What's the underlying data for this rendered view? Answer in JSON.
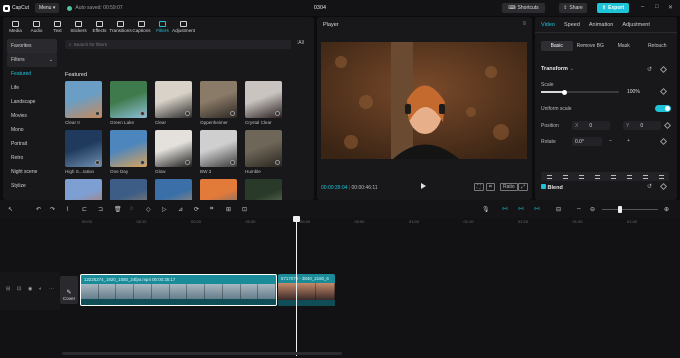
{
  "app": {
    "name": "CapCut",
    "menu_label": "Menu",
    "autosave": "Auto saved: 00:59:07",
    "project_title": "0304"
  },
  "header": {
    "shortcuts_label": "Shortcuts",
    "share_label": "Share",
    "export_label": "Export"
  },
  "toolbar": {
    "items": [
      {
        "label": "Media",
        "icon": "media-icon"
      },
      {
        "label": "Audio",
        "icon": "audio-icon"
      },
      {
        "label": "Text",
        "icon": "text-icon"
      },
      {
        "label": "Stickers",
        "icon": "stickers-icon"
      },
      {
        "label": "Effects",
        "icon": "effects-icon"
      },
      {
        "label": "Transitions",
        "icon": "transitions-icon"
      },
      {
        "label": "Captions",
        "icon": "captions-icon"
      },
      {
        "label": "Filters",
        "icon": "filters-icon"
      },
      {
        "label": "Adjustment",
        "icon": "adjustment-icon"
      }
    ],
    "active": "Filters"
  },
  "sidebar": {
    "items": [
      "Favorites",
      "Filters",
      "Featured",
      "Life",
      "Landscape",
      "Movies",
      "Mono",
      "Portrait",
      "Retro",
      "Night scene",
      "Stylize"
    ]
  },
  "search": {
    "placeholder": "Search for filters",
    "filter_label": "All"
  },
  "filters": {
    "section_title": "Featured",
    "items": [
      {
        "label": "Clear II",
        "colors": [
          "#6a9ec4",
          "#c98a5a"
        ]
      },
      {
        "label": "Green Lake",
        "colors": [
          "#3f7a4c",
          "#8dc0d8"
        ]
      },
      {
        "label": "Clear",
        "colors": [
          "#d8d2c8",
          "#2b2b2b"
        ]
      },
      {
        "label": "Oppenheimer",
        "colors": [
          "#8a7a68",
          "#2d2722"
        ]
      },
      {
        "label": "Crystal Clear",
        "colors": [
          "#c9c4c0",
          "#2a2020"
        ]
      },
      {
        "label": "High S...ration",
        "colors": [
          "#1f3a5c",
          "#6f8fb2"
        ]
      },
      {
        "label": "One Day",
        "colors": [
          "#4d86bd",
          "#d9a35a"
        ]
      },
      {
        "label": "Glow",
        "colors": [
          "#e4e1dc",
          "#1e1e1e"
        ]
      },
      {
        "label": "BW 3",
        "colors": [
          "#cfcfcf",
          "#3a3a3a"
        ]
      },
      {
        "label": "Humble",
        "colors": [
          "#6e6658",
          "#2a251f"
        ]
      },
      {
        "label": "",
        "colors": [
          "#7d9fd1",
          "#d46a3a"
        ]
      },
      {
        "label": "",
        "colors": [
          "#3d5d86",
          "#b48a6a"
        ]
      },
      {
        "label": "",
        "colors": [
          "#3a6fa8",
          "#d09a56"
        ]
      },
      {
        "label": "",
        "colors": [
          "#e27a3a",
          "#3a6a8a"
        ]
      },
      {
        "label": "",
        "colors": [
          "#2a3a2a",
          "#7a8a6a"
        ]
      }
    ]
  },
  "player": {
    "title": "Player",
    "current_time": "00:00:39:04",
    "total_time": "00:00:46:11",
    "ratio_label": "Ratio"
  },
  "inspector": {
    "tabs": [
      "Video",
      "Speed",
      "Animation",
      "Adjustment"
    ],
    "active_tab": "Video",
    "subtabs": [
      "Basic",
      "Remove BG",
      "Mask",
      "Retouch"
    ],
    "transform_label": "Transform",
    "scale_label": "Scale",
    "scale_value": "100%",
    "scale_fraction": 0.3,
    "uniform_scale_label": "Uniform scale",
    "uniform_scale_on": true,
    "position_label": "Position",
    "pos_x_label": "X",
    "pos_x": "0",
    "pos_y_label": "Y",
    "pos_y": "0",
    "rotate_label": "Rotate",
    "rotate_value": "0.0°",
    "blend_label": "Blend"
  },
  "timeline": {
    "ticks": [
      "00:00",
      "00:10",
      "00:20",
      "00:30",
      "00:40",
      "00:50",
      "01:00",
      "01:10",
      "01:20",
      "01:30",
      "01:40"
    ],
    "cover_label": "Cover",
    "clips": [
      {
        "label": "12225274_1920_1080_24fps.mp4  00:00:35:17",
        "colors": [
          "#5d7585",
          "#a7b8c0"
        ]
      },
      {
        "label": "5717079 - 3840_2160_6",
        "colors": [
          "#3a2a28",
          "#c48a6a"
        ]
      }
    ]
  }
}
